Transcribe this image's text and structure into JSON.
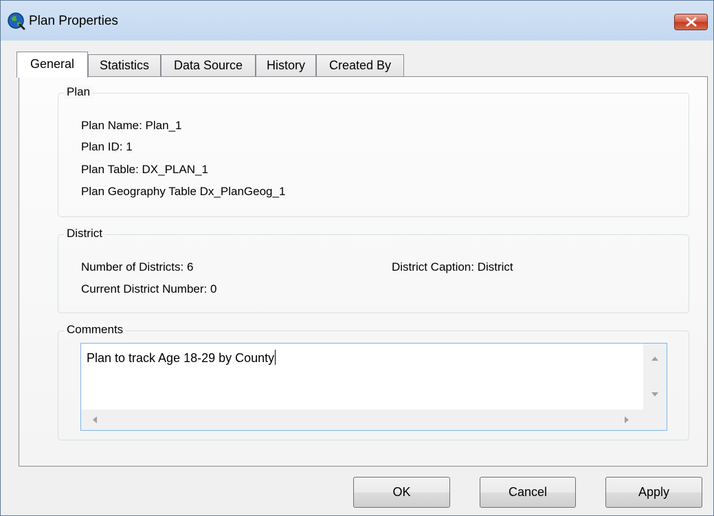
{
  "window": {
    "title": "Plan Properties"
  },
  "tabs": [
    {
      "label": "General",
      "active": true
    },
    {
      "label": "Statistics"
    },
    {
      "label": "Data Source"
    },
    {
      "label": "History"
    },
    {
      "label": "Created By"
    }
  ],
  "plan_group": {
    "legend": "Plan",
    "plan_name": "Plan Name: Plan_1",
    "plan_id": "Plan ID: 1",
    "plan_table": "Plan Table: DX_PLAN_1",
    "plan_geography_table": "Plan Geography Table Dx_PlanGeog_1"
  },
  "district_group": {
    "legend": "District",
    "number_of_districts": "Number of Districts: 6",
    "current_district_number": "Current District Number: 0",
    "district_caption": "District Caption: District"
  },
  "comments_group": {
    "legend": "Comments",
    "text": "Plan to track Age 18-29 by County"
  },
  "buttons": {
    "ok": "OK",
    "cancel": "Cancel",
    "apply": "Apply"
  },
  "colors": {
    "titlebar": "#c9dcf2",
    "close_button": "#d24a2d",
    "focus_border": "#7eb4ea"
  },
  "icons": {
    "app": "globe-icon",
    "close": "close-icon"
  }
}
